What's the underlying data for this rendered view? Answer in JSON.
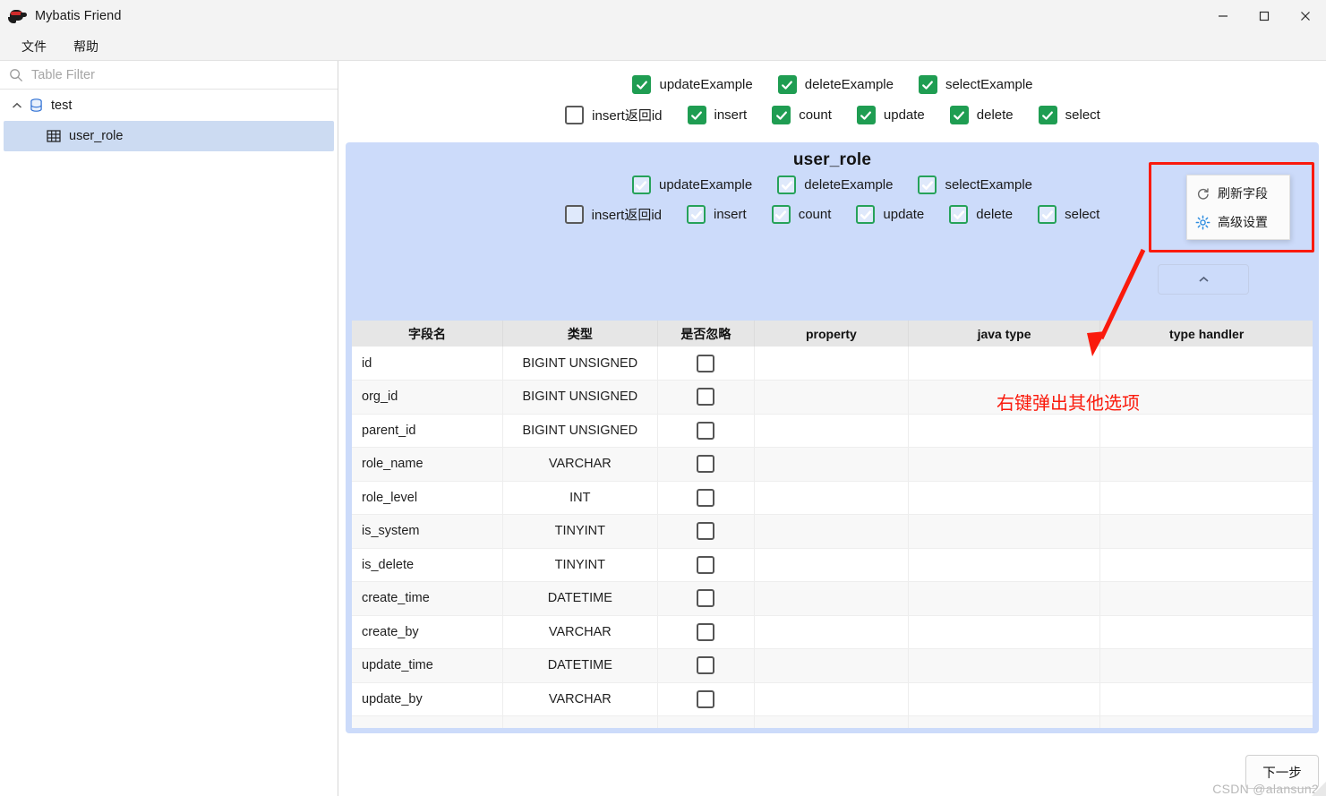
{
  "window": {
    "title": "Mybatis Friend",
    "app_icon": "ninja-logo-icon",
    "minimize": "minimize-icon",
    "maximize": "maximize-icon",
    "close": "close-icon"
  },
  "menubar": {
    "items": [
      "文件",
      "帮助"
    ]
  },
  "sidebar": {
    "filter": {
      "placeholder": "Table Filter",
      "value": "",
      "icon": "search-icon"
    },
    "tree": {
      "root": {
        "label": "test",
        "icon": "database-icon",
        "expanded": true,
        "chevron": "chevron-up-icon"
      },
      "children": [
        {
          "label": "user_role",
          "icon": "table-icon",
          "selected": true
        }
      ]
    }
  },
  "toolbar": {
    "row1": [
      {
        "label": "updateExample",
        "checked": true
      },
      {
        "label": "deleteExample",
        "checked": true
      },
      {
        "label": "selectExample",
        "checked": true
      }
    ],
    "row2": [
      {
        "label": "insert返回id",
        "checked": false
      },
      {
        "label": "insert",
        "checked": true
      },
      {
        "label": "count",
        "checked": true
      },
      {
        "label": "update",
        "checked": true
      },
      {
        "label": "delete",
        "checked": true
      },
      {
        "label": "select",
        "checked": true
      }
    ]
  },
  "panel": {
    "title": "user_role",
    "collapse_icon": "chevron-up-icon",
    "row1": [
      {
        "label": "updateExample",
        "checked": true
      },
      {
        "label": "deleteExample",
        "checked": true
      },
      {
        "label": "selectExample",
        "checked": true
      }
    ],
    "row2": [
      {
        "label": "insert返回id",
        "checked": false
      },
      {
        "label": "insert",
        "checked": true
      },
      {
        "label": "count",
        "checked": true
      },
      {
        "label": "update",
        "checked": true
      },
      {
        "label": "delete",
        "checked": true
      },
      {
        "label": "select",
        "checked": true
      }
    ],
    "table": {
      "columns": [
        "字段名",
        "类型",
        "是否忽略",
        "property",
        "java type",
        "type handler"
      ],
      "rows": [
        {
          "name": "id",
          "type": "BIGINT UNSIGNED",
          "ignore": false,
          "property": "",
          "java_type": "",
          "type_handler": ""
        },
        {
          "name": "org_id",
          "type": "BIGINT UNSIGNED",
          "ignore": false,
          "property": "",
          "java_type": "",
          "type_handler": ""
        },
        {
          "name": "parent_id",
          "type": "BIGINT UNSIGNED",
          "ignore": false,
          "property": "",
          "java_type": "",
          "type_handler": ""
        },
        {
          "name": "role_name",
          "type": "VARCHAR",
          "ignore": false,
          "property": "",
          "java_type": "",
          "type_handler": ""
        },
        {
          "name": "role_level",
          "type": "INT",
          "ignore": false,
          "property": "",
          "java_type": "",
          "type_handler": ""
        },
        {
          "name": "is_system",
          "type": "TINYINT",
          "ignore": false,
          "property": "",
          "java_type": "",
          "type_handler": ""
        },
        {
          "name": "is_delete",
          "type": "TINYINT",
          "ignore": false,
          "property": "",
          "java_type": "",
          "type_handler": ""
        },
        {
          "name": "create_time",
          "type": "DATETIME",
          "ignore": false,
          "property": "",
          "java_type": "",
          "type_handler": ""
        },
        {
          "name": "create_by",
          "type": "VARCHAR",
          "ignore": false,
          "property": "",
          "java_type": "",
          "type_handler": ""
        },
        {
          "name": "update_time",
          "type": "DATETIME",
          "ignore": false,
          "property": "",
          "java_type": "",
          "type_handler": ""
        },
        {
          "name": "update_by",
          "type": "VARCHAR",
          "ignore": false,
          "property": "",
          "java_type": "",
          "type_handler": ""
        }
      ]
    }
  },
  "context_menu": {
    "items": [
      {
        "label": "刷新字段",
        "icon": "refresh-icon"
      },
      {
        "label": "高级设置",
        "icon": "gear-icon"
      }
    ]
  },
  "annotation": {
    "text": "右键弹出其他选项",
    "color": "#fa1a0c"
  },
  "footer": {
    "next_label": "下一步",
    "watermark": "CSDN @alansun2"
  },
  "colors": {
    "panel_blue": "#ccdbfa",
    "checkbox_green": "#1f9d52",
    "selection_blue": "#ccdbf2",
    "annotation_red": "#fa1a0c",
    "header_gray": "#e6e6e6"
  }
}
